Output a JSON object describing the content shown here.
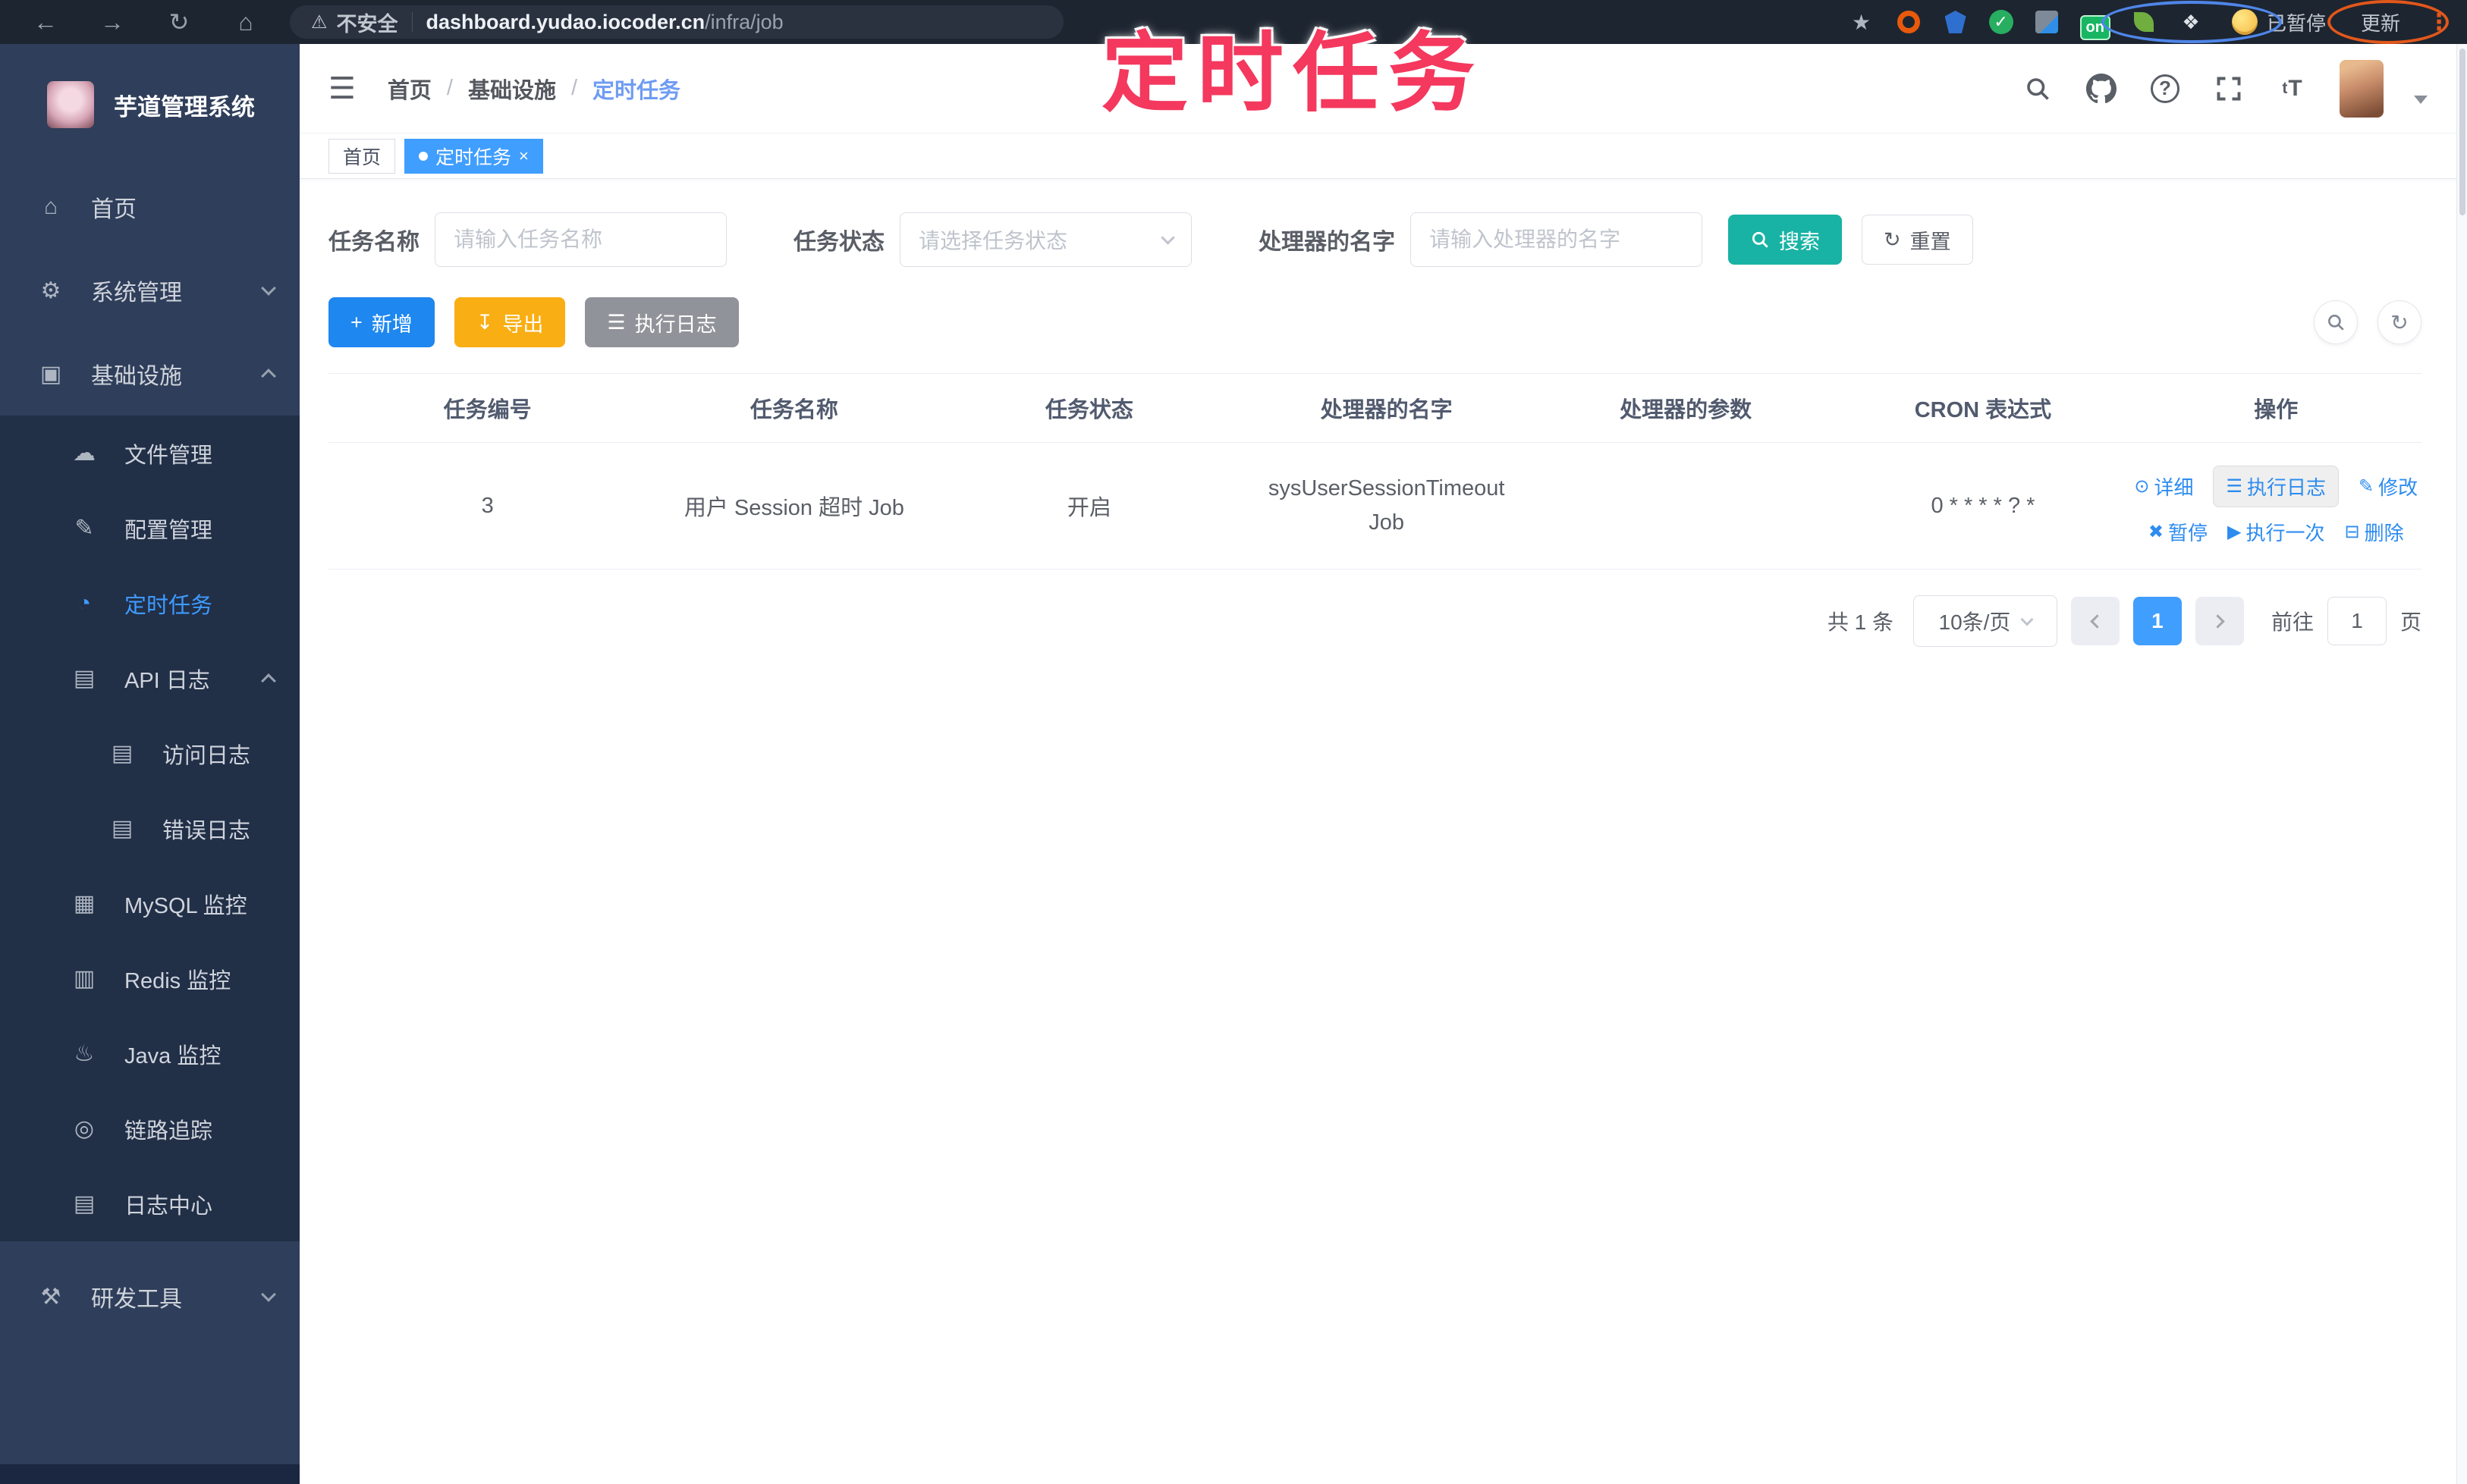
{
  "browser": {
    "security_label": "不安全",
    "url_host": "dashboard.yudao.iocoder.cn",
    "url_path": "/infra/job",
    "on_badge": "on",
    "paused_label": "已暂停",
    "update_label": "更新"
  },
  "sidebar": {
    "title": "芋道管理系统",
    "items": [
      {
        "label": "首页",
        "icon": "home-icon"
      },
      {
        "label": "系统管理",
        "icon": "gear-icon"
      },
      {
        "label": "基础设施",
        "icon": "monitor-icon"
      },
      {
        "label": "文件管理",
        "icon": "cloud-icon"
      },
      {
        "label": "配置管理",
        "icon": "edit-icon"
      },
      {
        "label": "定时任务",
        "icon": "clock-icon"
      },
      {
        "label": "API 日志",
        "icon": "log-icon"
      },
      {
        "label": "访问日志",
        "icon": "log-icon"
      },
      {
        "label": "错误日志",
        "icon": "log-icon"
      },
      {
        "label": "MySQL 监控",
        "icon": "database-icon"
      },
      {
        "label": "Redis 监控",
        "icon": "layers-icon"
      },
      {
        "label": "Java 监控",
        "icon": "java-icon"
      },
      {
        "label": "链路追踪",
        "icon": "eye-icon"
      },
      {
        "label": "日志中心",
        "icon": "log-icon"
      },
      {
        "label": "研发工具",
        "icon": "tools-icon"
      }
    ]
  },
  "header": {
    "breadcrumb": [
      "首页",
      "基础设施",
      "定时任务"
    ],
    "separator": "/",
    "tabs": [
      {
        "label": "首页"
      },
      {
        "label": "定时任务",
        "close": "×"
      }
    ]
  },
  "overlay_title": "定时任务",
  "filters": {
    "name_label": "任务名称",
    "name_placeholder": "请输入任务名称",
    "status_label": "任务状态",
    "status_placeholder": "请选择任务状态",
    "handler_label": "处理器的名字",
    "handler_placeholder": "请输入处理器的名字",
    "search_label": "搜索",
    "reset_label": "重置"
  },
  "toolbar": {
    "add_label": "新增",
    "export_label": "导出",
    "exec_log_label": "执行日志"
  },
  "table": {
    "headers": [
      "任务编号",
      "任务名称",
      "任务状态",
      "处理器的名字",
      "处理器的参数",
      "CRON 表达式",
      "操作"
    ],
    "row": {
      "id": "3",
      "name": "用户 Session 超时 Job",
      "status": "开启",
      "handler": "sysUserSessionTimeoutJob",
      "param": "",
      "cron": "0 * * * * ? *",
      "actions_line1": [
        "详细",
        "执行日志",
        "修改"
      ],
      "actions_line2": [
        "暂停",
        "执行一次",
        "删除"
      ]
    }
  },
  "pagination": {
    "total": "共 1 条",
    "page_size": "10条/页",
    "current_page": "1",
    "goto_label": "前往",
    "goto_value": "1",
    "page_unit": "页"
  },
  "icons": {
    "back": "←",
    "forward": "→",
    "reload": "↻",
    "home_nav": "⌂",
    "warning": "⚠",
    "star": "★",
    "puzzle": "❖",
    "kebab": "⋮",
    "hamburger": "☰",
    "home": "⌂",
    "gear": "⚙",
    "monitor": "▣",
    "cloud": "☁",
    "edit": "✎",
    "clock": "◔",
    "log": "▤",
    "database": "▦",
    "layers": "▥",
    "java": "♨",
    "eye": "◎",
    "tools": "⚒",
    "plus": "+",
    "download": "↧",
    "list": "☰",
    "detail": "⊙",
    "exec": "☰",
    "modify": "✎",
    "pause": "✖",
    "run_once": "▶",
    "delete": "⊟",
    "refresh": "↻",
    "font_size": "tT"
  },
  "colors": {
    "accent_blue": "#409eff",
    "link_blue": "#2d8cf0",
    "search_teal": "#18b3a4",
    "export_yellow": "#f9ae13",
    "info_gray": "#909399",
    "annotation_pink": "#f4385e",
    "annotation_blue": "#4f86e8",
    "annotation_orange": "#e2571b",
    "sidebar_bg": "#2f3e5a",
    "submenu_bg": "#212f47"
  }
}
